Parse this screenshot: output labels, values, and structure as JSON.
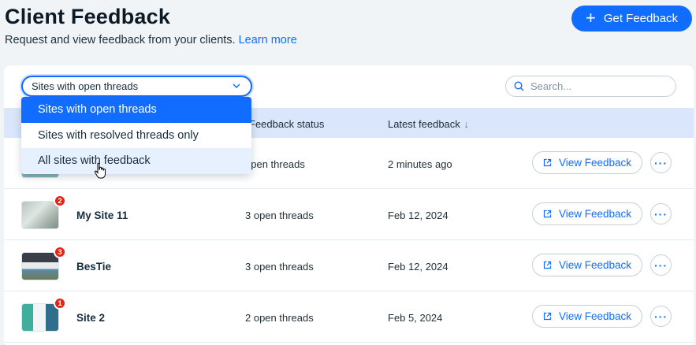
{
  "header": {
    "title": "Client Feedback",
    "subtitle": "Request and view feedback from your clients.",
    "learn_more": "Learn more",
    "get_feedback_label": "Get Feedback"
  },
  "filter": {
    "selected": "Sites with open threads",
    "options": [
      "Sites with open threads",
      "Sites with resolved threads only",
      "All sites with feedback"
    ]
  },
  "search": {
    "placeholder": "Search..."
  },
  "table": {
    "columns": {
      "status": "Feedback status",
      "latest": "Latest feedback"
    },
    "rows": [
      {
        "name": "",
        "badge": "",
        "status": "open threads",
        "latest": "2 minutes ago",
        "action": "View Feedback"
      },
      {
        "name": "My Site 11",
        "badge": "2",
        "status": "3 open threads",
        "latest": "Feb 12, 2024",
        "action": "View Feedback"
      },
      {
        "name": "BesTie",
        "badge": "3",
        "status": "3 open threads",
        "latest": "Feb 12, 2024",
        "action": "View Feedback"
      },
      {
        "name": "Site 2",
        "badge": "1",
        "status": "2 open threads",
        "latest": "Feb 5, 2024",
        "action": "View Feedback"
      }
    ]
  },
  "colors": {
    "accent": "#116dff",
    "badge": "#e62214",
    "header_bg": "#d9e6fb"
  }
}
